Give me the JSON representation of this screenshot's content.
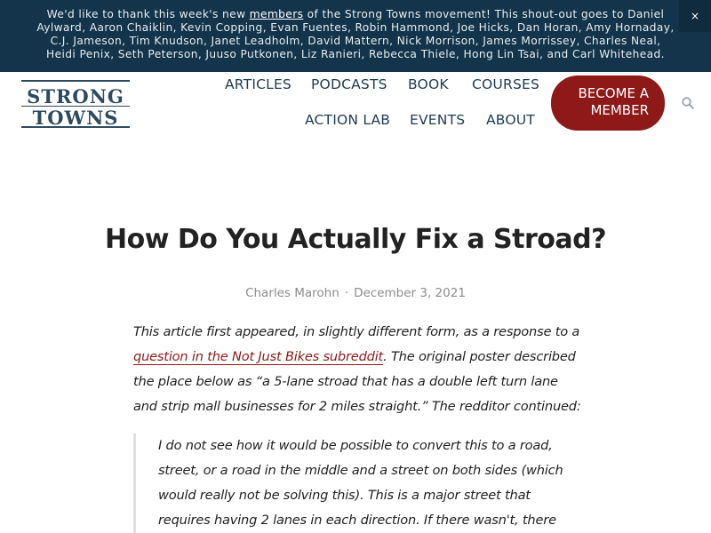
{
  "announcement": {
    "before_link": "We'd like to thank this week's new ",
    "link_text": "members",
    "after_link": " of the Strong Towns movement! This shout-out goes to Daniel Aylward, Aaron Chaiklin, Kevin Copping, Evan Fuentes, Robin Hammond, Joe Hicks, Dan Horan, Amy Hornaday, C.J. Jameson, Tim Knudson, Janet Leadholm, David Mattern, Nick Morrison, James Morrissey, Charles Neal, Heidi Penix, Seth Peterson, Juuso Putkonen, Liz Ranieri, Rebecca Thiele, Hong Lin Tsai, and Carl Whitehead.",
    "close_label": "×"
  },
  "logo": {
    "line1": "STRONG",
    "line2": "TOWNS"
  },
  "nav": {
    "row1": [
      "ARTICLES",
      "PODCASTS",
      "BOOK",
      "COURSES"
    ],
    "row2": [
      "ACTION LAB",
      "EVENTS",
      "ABOUT"
    ],
    "cta_line1": "BECOME A",
    "cta_line2": "MEMBER"
  },
  "article": {
    "title": "How Do You Actually Fix a Stroad?",
    "author": "Charles Marohn",
    "separator": "·",
    "date": "December 3, 2021",
    "intro_before": "This article first appeared, in slightly different form, as a response to a ",
    "intro_link": "question in the Not Just Bikes subreddit",
    "intro_after": ". The original poster described the place below as “a 5-lane stroad that has a double left turn lane and strip mall businesses for 2 miles straight.” The redditor continued:",
    "quote": "I do not see how it would be possible to convert this to a road, street, or a road in the middle and a street on both sides (which would really not be solving this). This is a major street that requires having 2 lanes in each direction. If there wasn't, there would be too much traffic. There are also"
  },
  "colors": {
    "brand_navy": "#13344a",
    "accent_red": "#8e1919"
  },
  "icons": {
    "search": "search-icon",
    "close": "close-icon"
  }
}
